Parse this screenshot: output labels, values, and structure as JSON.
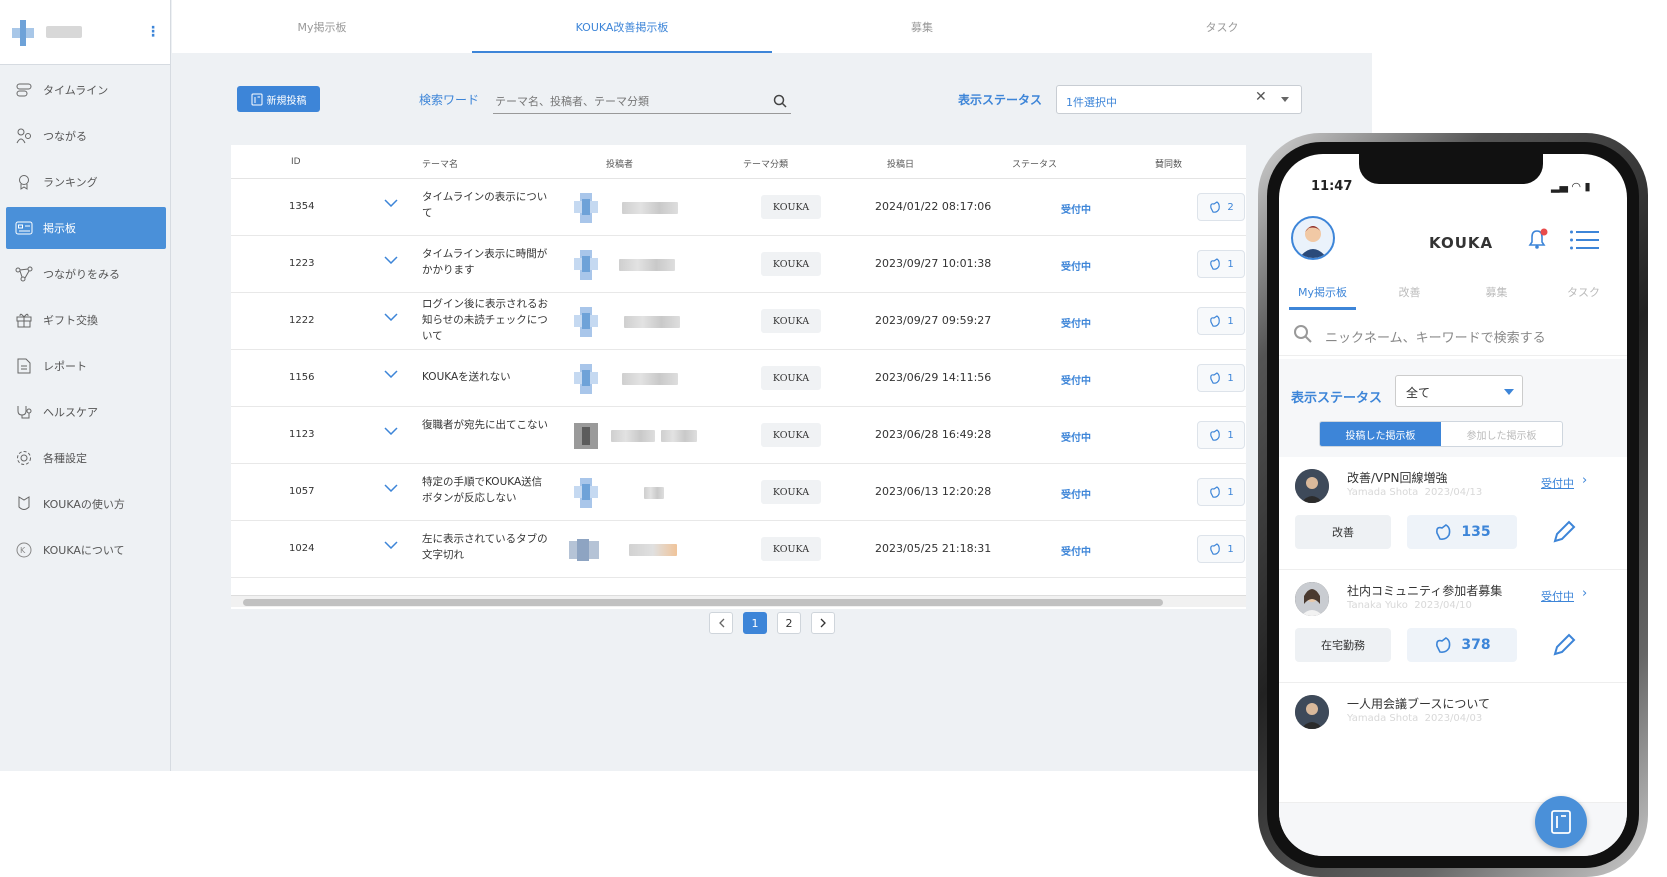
{
  "sidebar": {
    "items": [
      {
        "label": "タイムライン",
        "icon": "timeline-icon"
      },
      {
        "label": "つながる",
        "icon": "connect-icon"
      },
      {
        "label": "ランキング",
        "icon": "ranking-icon"
      },
      {
        "label": "掲示板",
        "icon": "board-icon",
        "active": true
      },
      {
        "label": "つながりをみる",
        "icon": "network-icon"
      },
      {
        "label": "ギフト交換",
        "icon": "gift-icon"
      },
      {
        "label": "レポート",
        "icon": "report-icon"
      },
      {
        "label": "ヘルスケア",
        "icon": "healthcare-icon"
      },
      {
        "label": "各種設定",
        "icon": "settings-gear-icon"
      },
      {
        "label": "KOUKAの使い方",
        "icon": "guide-icon"
      },
      {
        "label": "KOUKAについて",
        "icon": "about-icon"
      }
    ]
  },
  "tabs": [
    {
      "label": "My掲示板"
    },
    {
      "label": "KOUKA改善掲示板",
      "active": true
    },
    {
      "label": "募集"
    },
    {
      "label": "タスク"
    }
  ],
  "toolbar": {
    "new_post_label": "新規投稿",
    "keyword_label": "検索ワード",
    "keyword_placeholder": "テーマ名、投稿者、テーマ分類",
    "status_label": "表示ステータス",
    "status_value": "1件選択中"
  },
  "table": {
    "headers": {
      "id": "ID",
      "title": "テーマ名",
      "author": "投稿者",
      "category": "テーマ分類",
      "date": "投稿日",
      "status": "ステータス",
      "likes": "賛同数"
    },
    "rows": [
      {
        "id": "1354",
        "title": "タイムラインの表示について",
        "category": "KOUKA",
        "date": "2024/01/22 08:17:06",
        "status": "受付中",
        "likes": "2"
      },
      {
        "id": "1223",
        "title": "タイムライン表示に時間がかかります",
        "category": "KOUKA",
        "date": "2023/09/27 10:01:38",
        "status": "受付中",
        "likes": "1"
      },
      {
        "id": "1222",
        "title": "ログイン後に表示されるお知らせの未読チェックについて",
        "category": "KOUKA",
        "date": "2023/09/27 09:59:27",
        "status": "受付中",
        "likes": "1"
      },
      {
        "id": "1156",
        "title": "KOUKAを送れない",
        "category": "KOUKA",
        "date": "2023/06/29 14:11:56",
        "status": "受付中",
        "likes": "1"
      },
      {
        "id": "1123",
        "title": "復職者が宛先に出てこない",
        "category": "KOUKA",
        "date": "2023/06/28 16:49:28",
        "status": "受付中",
        "likes": "1"
      },
      {
        "id": "1057",
        "title": "特定の手順でKOUKA送信ボタンが反応しない",
        "category": "KOUKA",
        "date": "2023/06/13 12:20:28",
        "status": "受付中",
        "likes": "1"
      },
      {
        "id": "1024",
        "title": "左に表示されているタブの文字切れ",
        "category": "KOUKA",
        "date": "2023/05/25 21:18:31",
        "status": "受付中",
        "likes": "1"
      }
    ]
  },
  "pagination": {
    "pages": [
      "1",
      "2"
    ],
    "current": "1"
  },
  "phone": {
    "time": "11:47",
    "app_title": "KOUKA",
    "tabs": [
      "My掲示板",
      "改善",
      "募集",
      "タスク"
    ],
    "search_placeholder": "ニックネーム、キーワードで検索する",
    "status_label": "表示ステータス",
    "status_value": "全て",
    "segments": [
      "投稿した掲示板",
      "参加した掲示板"
    ],
    "cards": [
      {
        "title": "改善/VPN回線増強",
        "author": "Yamada Shota",
        "date": "2023/04/13",
        "status": "受付中",
        "tag": "改善",
        "likes": "135"
      },
      {
        "title": "社内コミュニティ参加者募集",
        "author": "Tanaka Yuko",
        "date": "2023/04/10",
        "status": "受付中",
        "tag": "在宅勤務",
        "likes": "378"
      },
      {
        "title": "一人用会議ブースについて",
        "author": "Yamada Shota",
        "date": "2023/04/03",
        "status": "",
        "tag": "",
        "likes": ""
      }
    ]
  },
  "colors": {
    "accent": "#3d85d8",
    "sidebar_bg": "#eef1f4",
    "active_item": "#4a90d9"
  }
}
